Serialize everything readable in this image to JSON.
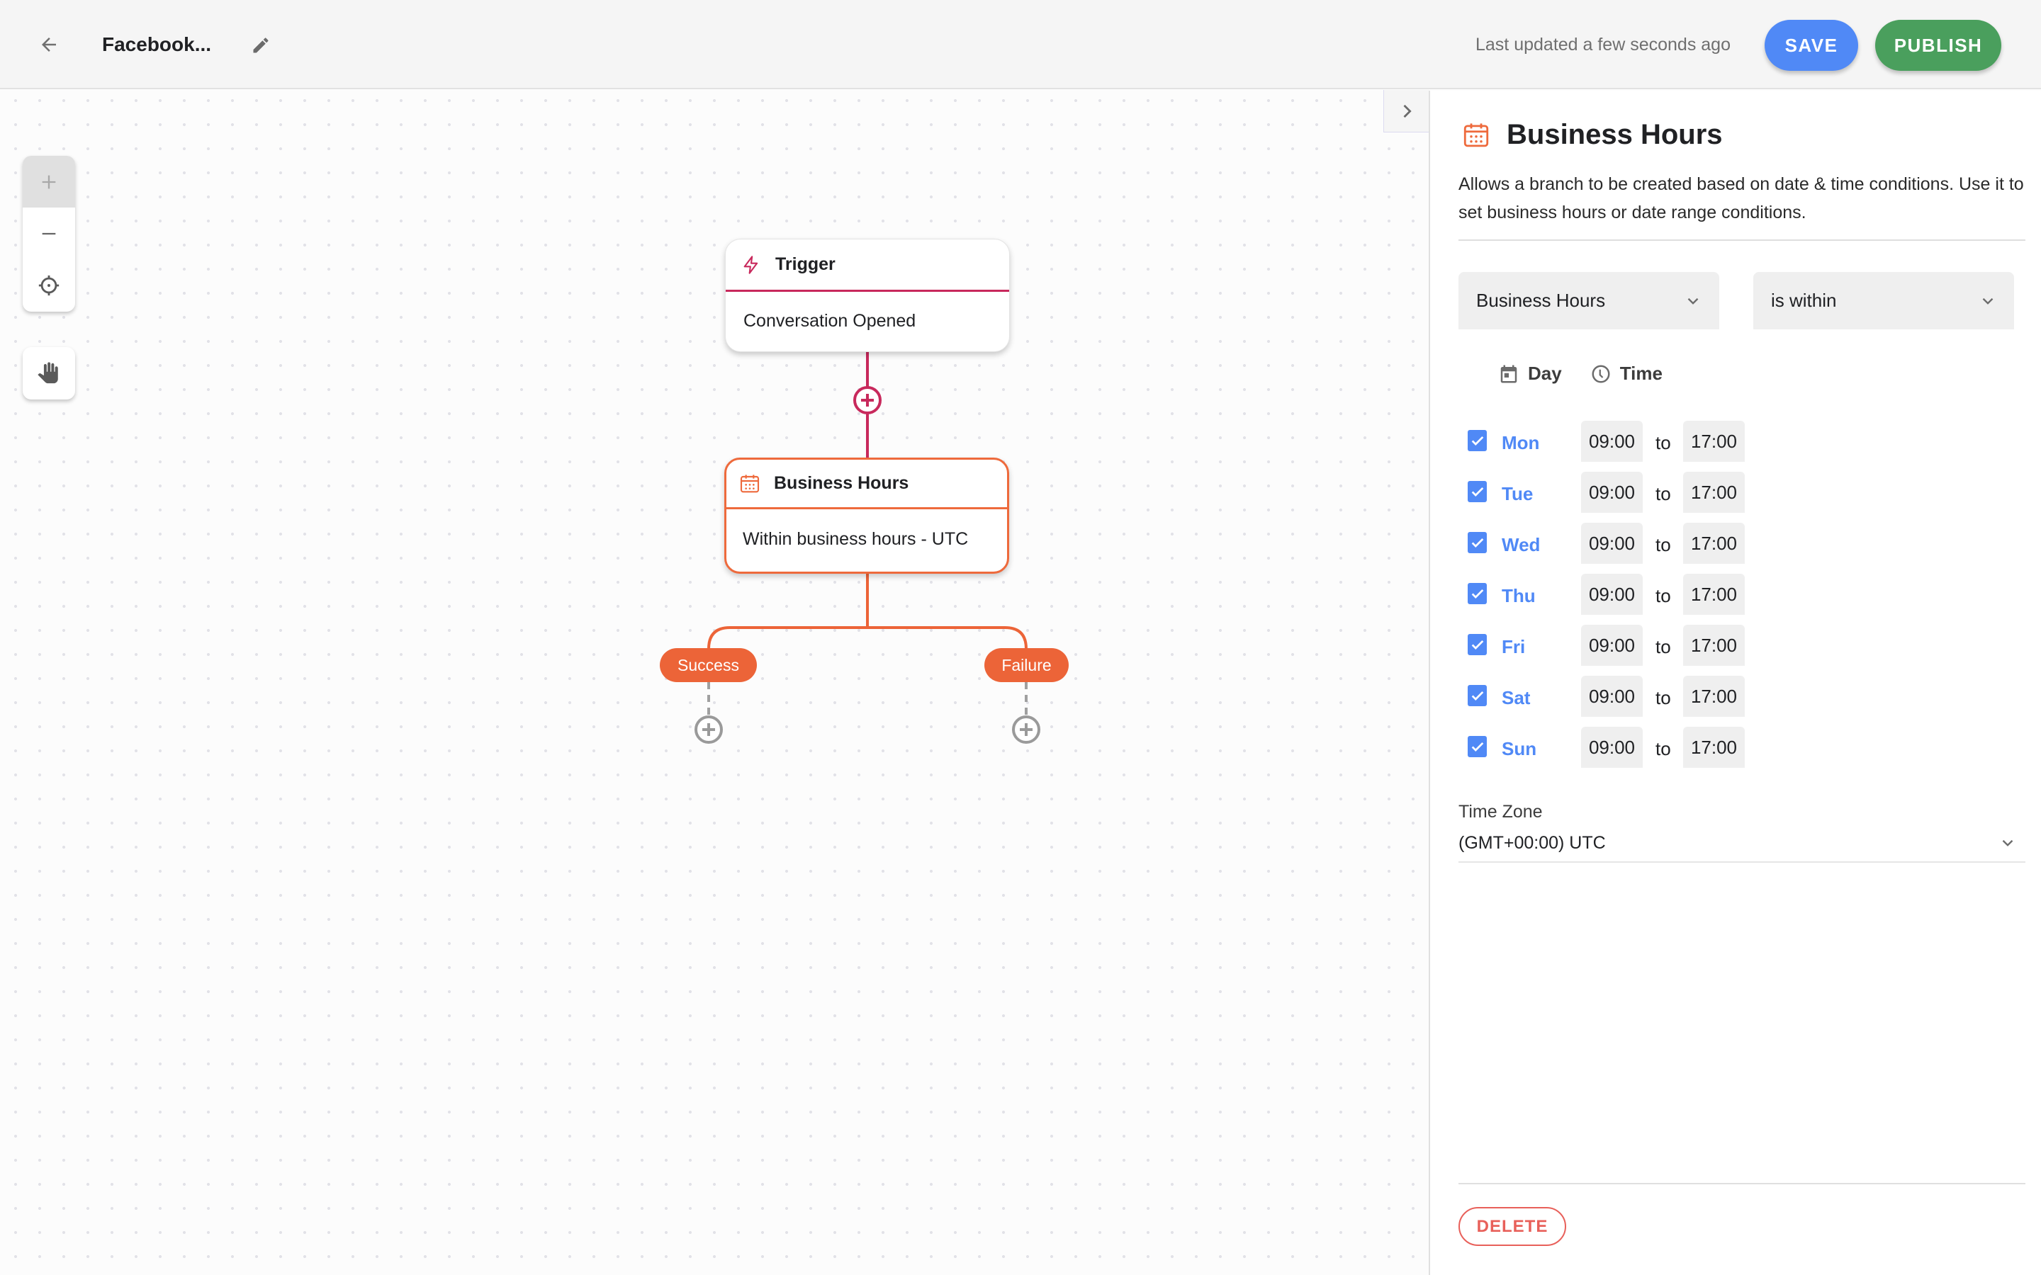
{
  "header": {
    "title": "Facebook...",
    "last_updated": "Last updated a few seconds ago",
    "save_label": "SAVE",
    "publish_label": "PUBLISH"
  },
  "colors": {
    "save": "#5089f6",
    "publish": "#4a9f5d",
    "trigger_accent": "#c8295c",
    "business_hours_accent": "#ee6a3c",
    "day_checked": "#5089f6",
    "delete": "#e8605a"
  },
  "canvas": {
    "controls": {
      "zoom_in_icon": "plus-icon",
      "zoom_out_icon": "minus-icon",
      "fit_icon": "crosshair-icon",
      "pan_icon": "hand-icon"
    },
    "nodes": [
      {
        "type": "trigger",
        "icon": "lightning-icon",
        "title": "Trigger",
        "body": "Conversation Opened"
      },
      {
        "type": "business_hours",
        "icon": "calendar-icon",
        "title": "Business Hours",
        "body": "Within business hours - UTC"
      }
    ],
    "branches": {
      "success": "Success",
      "failure": "Failure"
    }
  },
  "panel": {
    "title": "Business Hours",
    "description": "Allows a branch to be created based on date & time conditions. Use it to set business hours or date range conditions.",
    "condition_type": "Business Hours",
    "operator": "is within",
    "columns": {
      "day": "Day",
      "time": "Time"
    },
    "to_label": "to",
    "days": [
      {
        "day": "Mon",
        "checked": true,
        "start": "09:00",
        "end": "17:00"
      },
      {
        "day": "Tue",
        "checked": true,
        "start": "09:00",
        "end": "17:00"
      },
      {
        "day": "Wed",
        "checked": true,
        "start": "09:00",
        "end": "17:00"
      },
      {
        "day": "Thu",
        "checked": true,
        "start": "09:00",
        "end": "17:00"
      },
      {
        "day": "Fri",
        "checked": true,
        "start": "09:00",
        "end": "17:00"
      },
      {
        "day": "Sat",
        "checked": true,
        "start": "09:00",
        "end": "17:00"
      },
      {
        "day": "Sun",
        "checked": true,
        "start": "09:00",
        "end": "17:00"
      }
    ],
    "timezone_label": "Time Zone",
    "timezone_value": "(GMT+00:00) UTC",
    "delete_label": "DELETE"
  }
}
